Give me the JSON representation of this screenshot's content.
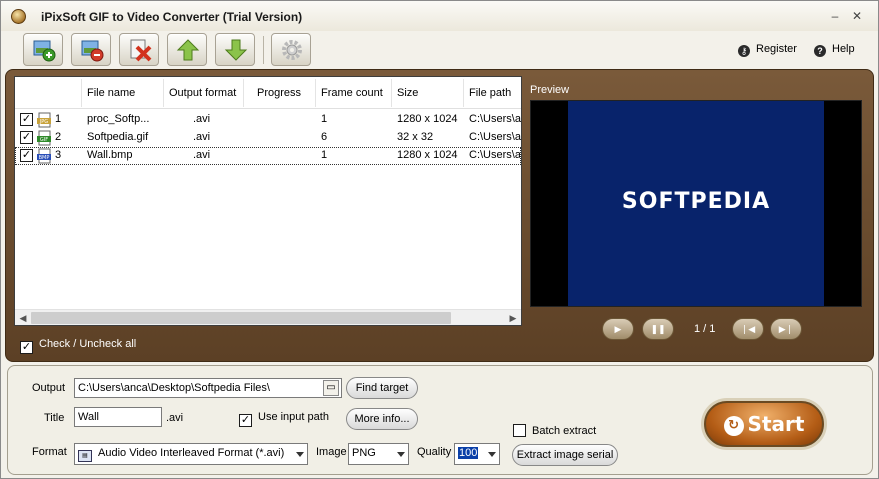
{
  "window": {
    "title": "iPixSoft GIF to Video Converter (Trial Version)",
    "minimize": "–",
    "maximize": "□",
    "close": "✕"
  },
  "toolbar": {
    "buttons": [
      {
        "icon": "add-file-icon"
      },
      {
        "icon": "remove-file-icon"
      },
      {
        "icon": "clear-list-icon"
      },
      {
        "icon": "move-up-icon"
      },
      {
        "icon": "move-down-icon"
      },
      {
        "icon": "settings-gear-icon"
      }
    ],
    "register_label": "Register",
    "help_label": "Help"
  },
  "file_list": {
    "columns": [
      "File name",
      "Output format",
      "Progress",
      "Frame count",
      "Size",
      "File path"
    ],
    "rows": [
      {
        "checked": true,
        "index": "1",
        "type": "JPG",
        "name": "proc_Softp...",
        "format": ".avi",
        "progress": "",
        "frames": "1",
        "size": "1280 x 1024",
        "path": "C:\\Users\\a"
      },
      {
        "checked": true,
        "index": "2",
        "type": "GIF",
        "name": "Softpedia.gif",
        "format": ".avi",
        "progress": "",
        "frames": "6",
        "size": "32 x 32",
        "path": "C:\\Users\\a"
      },
      {
        "checked": true,
        "index": "3",
        "type": "BMP",
        "name": "Wall.bmp",
        "format": ".avi",
        "progress": "",
        "frames": "1",
        "size": "1280 x 1024",
        "path": "C:\\Users\\a"
      }
    ],
    "check_all_label": "Check / Uncheck all",
    "check_all_checked": true
  },
  "preview": {
    "label": "Preview",
    "image_text": "SOFTPEDIA",
    "counter": "1 / 1",
    "colors": {
      "image_bg": "#08236b",
      "frame_bg": "#000000"
    }
  },
  "output": {
    "output_label": "Output",
    "output_path": "C:\\Users\\anca\\Desktop\\Softpedia Files\\",
    "find_target_label": "Find target",
    "title_label": "Title",
    "title_value": "Wall",
    "title_ext": ".avi",
    "use_input_path_label": "Use input path",
    "use_input_path_checked": true,
    "more_info_label": "More info...",
    "format_label": "Format",
    "format_value": "Audio Video Interleaved Format (*.avi)",
    "image_label": "Image",
    "image_value": "PNG",
    "quality_label": "Quality",
    "quality_value": "100",
    "batch_extract_label": "Batch extract",
    "batch_extract_checked": false,
    "extract_serial_label": "Extract image serial",
    "start_label": "Start"
  },
  "colors": {
    "brown_panel": "#6b4c2e",
    "start_button": "#b45d16"
  }
}
